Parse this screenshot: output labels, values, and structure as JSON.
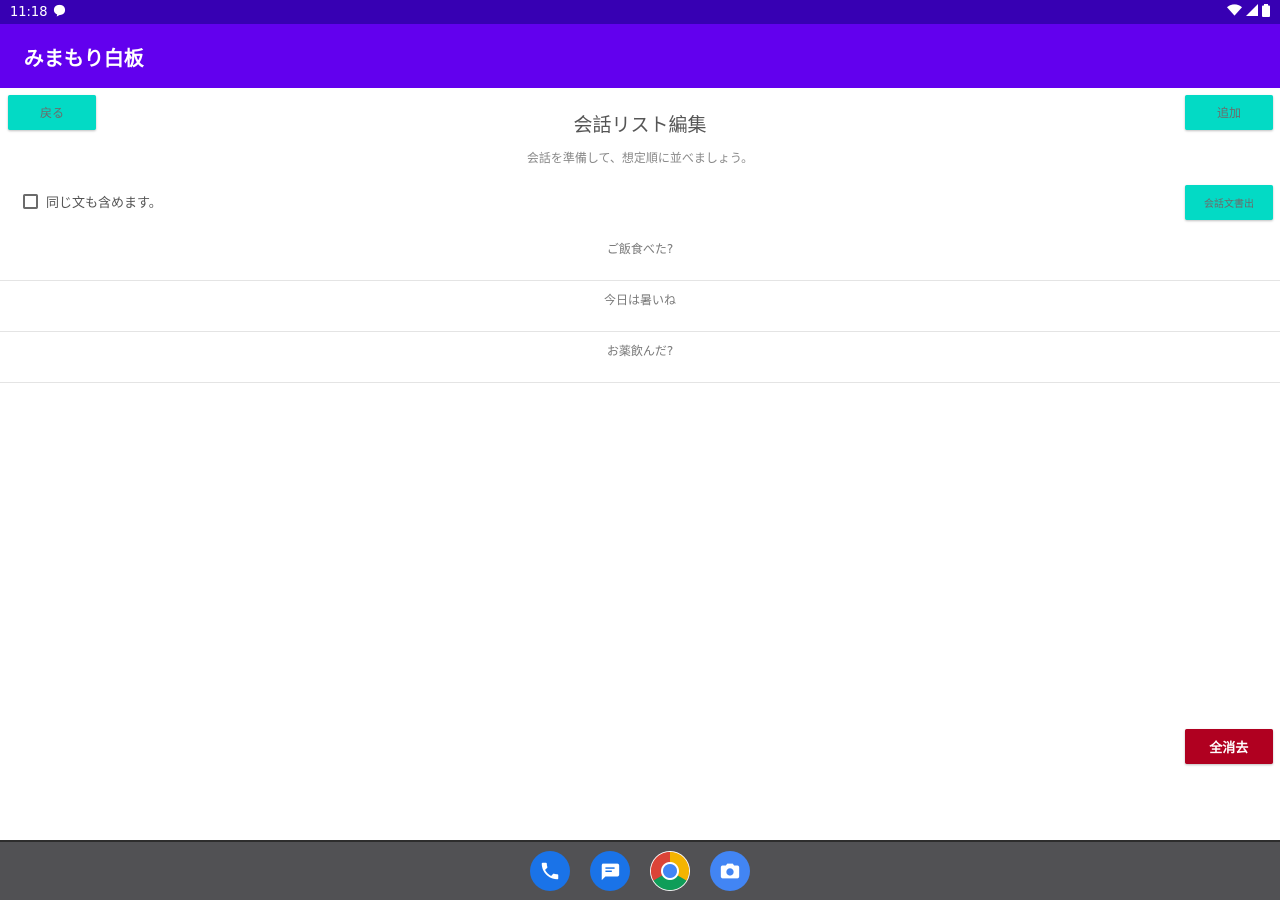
{
  "status_bar": {
    "time": "11:18"
  },
  "app_bar": {
    "title": "みまもり白板"
  },
  "toolbar": {
    "back_label": "戻る",
    "add_label": "追加",
    "export_label": "会話文書出",
    "clear_all_label": "全消去"
  },
  "page": {
    "title": "会話リスト編集",
    "subtitle": "会話を準備して、想定順に並べましょう。"
  },
  "options": {
    "include_same_text_label": "同じ文も含めます。",
    "include_same_text_checked": false
  },
  "conversation_list": {
    "items": [
      {
        "text": "ご飯食べた?"
      },
      {
        "text": "今日は暑いね"
      },
      {
        "text": "お薬飲んだ?"
      }
    ]
  },
  "dock": {
    "apps": [
      "phone-icon",
      "messages-icon",
      "chrome-icon",
      "camera-icon"
    ]
  },
  "colors": {
    "status_bar": "#3700b3",
    "app_bar": "#6200ee",
    "accent_button": "#03dac5",
    "danger_button": "#b00020",
    "nav_bar": "#515154"
  }
}
